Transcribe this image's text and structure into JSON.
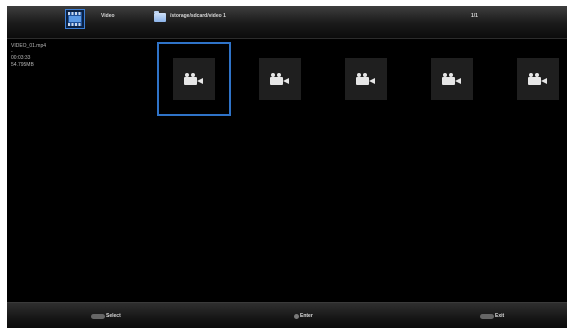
{
  "header": {
    "title": "Video",
    "path": "/storage/sdcard/video 1",
    "page": "1/1"
  },
  "info": {
    "filename": "VIDEO_01.mp4",
    "dash": "-",
    "duration": "00:03:33",
    "size": "54.795MB"
  },
  "thumbnails": [
    {
      "icon": "video-camera-icon",
      "selected": true
    },
    {
      "icon": "video-camera-icon",
      "selected": false
    },
    {
      "icon": "video-camera-icon",
      "selected": false
    },
    {
      "icon": "video-camera-icon",
      "selected": false
    },
    {
      "icon": "video-camera-icon",
      "selected": false
    }
  ],
  "footer": {
    "select_label": "Select",
    "enter_label": "Enter",
    "exit_label": "Exit"
  },
  "colors": {
    "selection": "#2f73c8",
    "background": "#000000"
  }
}
